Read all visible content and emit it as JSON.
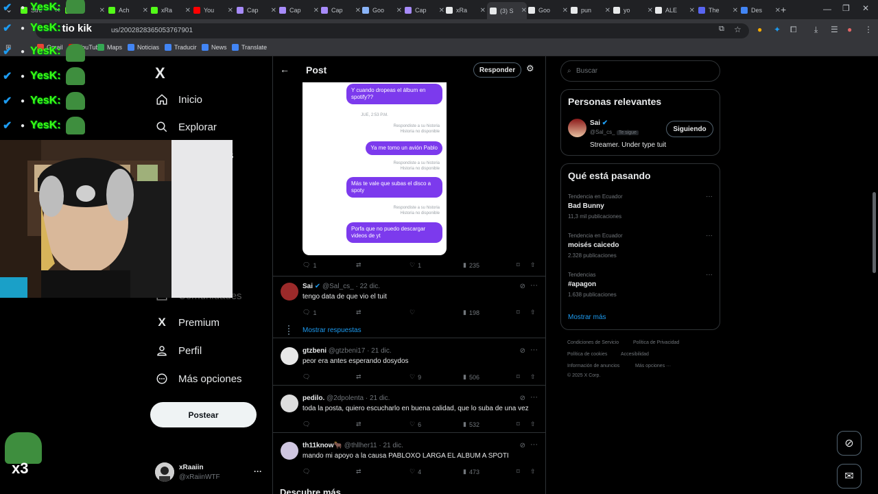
{
  "browser": {
    "tabs": [
      {
        "label": "Stre",
        "color": "#53fc18"
      },
      {
        "label": "",
        "color": "#53fc18"
      },
      {
        "label": "Ach",
        "color": "#53fc18"
      },
      {
        "label": "xRa",
        "color": "#53fc18"
      },
      {
        "label": "You",
        "color": "#ff0000"
      },
      {
        "label": "Cap",
        "color": "#a78bfa"
      },
      {
        "label": "Cap",
        "color": "#a78bfa"
      },
      {
        "label": "Cap",
        "color": "#a78bfa"
      },
      {
        "label": "Goo",
        "color": "#8ab4f8"
      },
      {
        "label": "Cap",
        "color": "#a78bfa"
      },
      {
        "label": "xRa",
        "color": "#e7e9ea"
      },
      {
        "label": "(3) S",
        "color": "#e7e9ea"
      },
      {
        "label": "Goo",
        "color": "#e7e9ea"
      },
      {
        "label": "pun",
        "color": "#e7e9ea"
      },
      {
        "label": "yo",
        "color": "#e7e9ea"
      },
      {
        "label": "ALE",
        "color": "#e7e9ea"
      },
      {
        "label": "The",
        "color": "#5865f2"
      },
      {
        "label": "Des",
        "color": "#4285f4"
      }
    ],
    "url_suffix": "us/2002828365053767901",
    "bookmarks": [
      "Gmail",
      "YouTube",
      "Maps",
      "Noticias",
      "Traducir",
      "News",
      "Translate"
    ]
  },
  "overlay": {
    "chat_name": "YesK:",
    "chat_text": "tio kik",
    "counter": "x3"
  },
  "nav": {
    "logo": "X",
    "items": [
      "Inicio",
      "Explorar",
      "s",
      "Comunidades",
      "Premium",
      "Perfil",
      "Más opciones"
    ],
    "post_button": "Postear",
    "account_name": "xRaaiin",
    "account_handle": "@xRaiinWTF",
    "account_more": "···"
  },
  "post": {
    "title": "Post",
    "reply_button": "Responder",
    "screenshot": {
      "bubbles": [
        "Y cuando dropeas el álbum en spotify??",
        "Ya me tomo un avión Pablo",
        "Más te vale que subas el disco a spoty",
        "Porfa que no puedo descargar videos de yt"
      ],
      "day_label": "JUE, 2:53 P.M.",
      "meta_replied": "Respondiste a su historia",
      "meta_unavailable": "Historia no disponible"
    },
    "stats": {
      "replies": "1",
      "likes": "1",
      "views": "235"
    }
  },
  "tweets": [
    {
      "name": "Sai",
      "handle": "@Sal_cs_",
      "date": "· 22 dic.",
      "text": "tengo data de que vio el tuit",
      "replies": "1",
      "retweets": "",
      "likes": "",
      "views": "198",
      "verified": true
    },
    {
      "name": "gtzbeni",
      "handle": "@gtzbeni17",
      "date": "· 21 dic.",
      "text": "peor era antes esperando dosydos",
      "replies": "",
      "retweets": "",
      "likes": "9",
      "views": "506",
      "verified": false
    },
    {
      "name": "pedilo.",
      "handle": "@2dpolenta",
      "date": "· 21 dic.",
      "text": "toda la posta, quiero escucharlo en buena calidad, que lo suba de una vez",
      "replies": "",
      "retweets": "",
      "likes": "6",
      "views": "532",
      "verified": false
    },
    {
      "name": "th11know🐂",
      "handle": "@thllher11",
      "date": "· 21 dic.",
      "text": "mando mi apoyo a la causa PABLOXO LARGA EL ALBUM A SPOTI",
      "replies": "",
      "retweets": "",
      "likes": "4",
      "views": "473",
      "verified": false
    }
  ],
  "show_replies": "Mostrar respuestas",
  "discover": "Descubre más",
  "sidebar": {
    "search_placeholder": "Buscar",
    "relevant_title": "Personas relevantes",
    "relevant_name": "Sai",
    "relevant_handle": "@Sal_cs_",
    "follows_you": "Te sigue",
    "follow_button": "Siguiendo",
    "relevant_bio": "Streamer. Under type tuit",
    "trends_title": "Qué está pasando",
    "trends": [
      {
        "context": "Tendencia en Ecuador",
        "name": "Bad Bunny",
        "count": "11,3 mil publicaciones"
      },
      {
        "context": "Tendencia en Ecuador",
        "name": "moisés caicedo",
        "count": "2.328 publicaciones"
      },
      {
        "context": "Tendencias",
        "name": "#apagon",
        "count": "1.638 publicaciones"
      }
    ],
    "show_more": "Mostrar más",
    "footer": [
      "Condiciones de Servicio",
      "Política de Privacidad",
      "Política de cookies",
      "Accesibilidad",
      "Información de anuncios",
      "Más opciones ···",
      "© 2025 X Corp."
    ]
  },
  "colors": {
    "accent": "#1d9bf0",
    "bubble": "#7c3aed",
    "chat_name": "#39ff14"
  }
}
